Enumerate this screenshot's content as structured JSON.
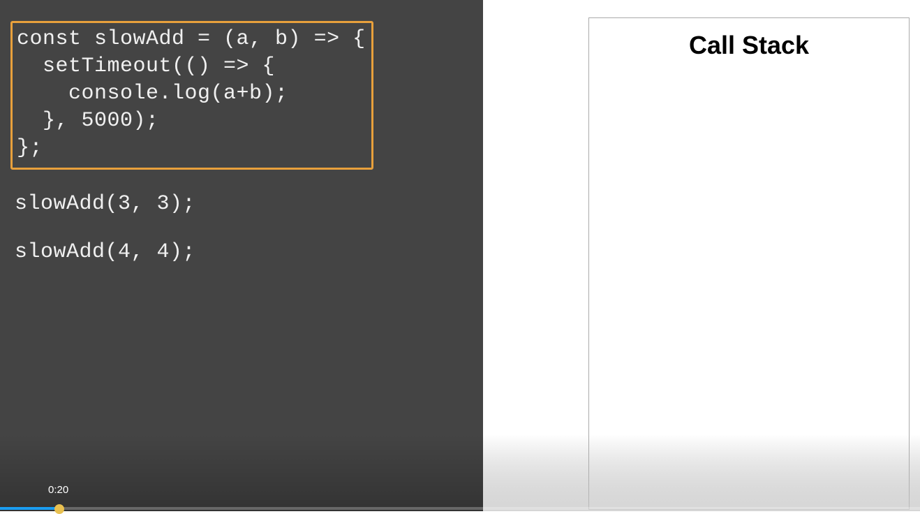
{
  "code": {
    "highlighted": "const slowAdd = (a, b) => {\n  setTimeout(() => {\n    console.log(a+b);\n  }, 5000);\n};",
    "line1": "slowAdd(3, 3);",
    "line2": "slowAdd(4, 4);"
  },
  "callstack": {
    "title": "Call Stack"
  },
  "video": {
    "timestamp": "0:20"
  }
}
